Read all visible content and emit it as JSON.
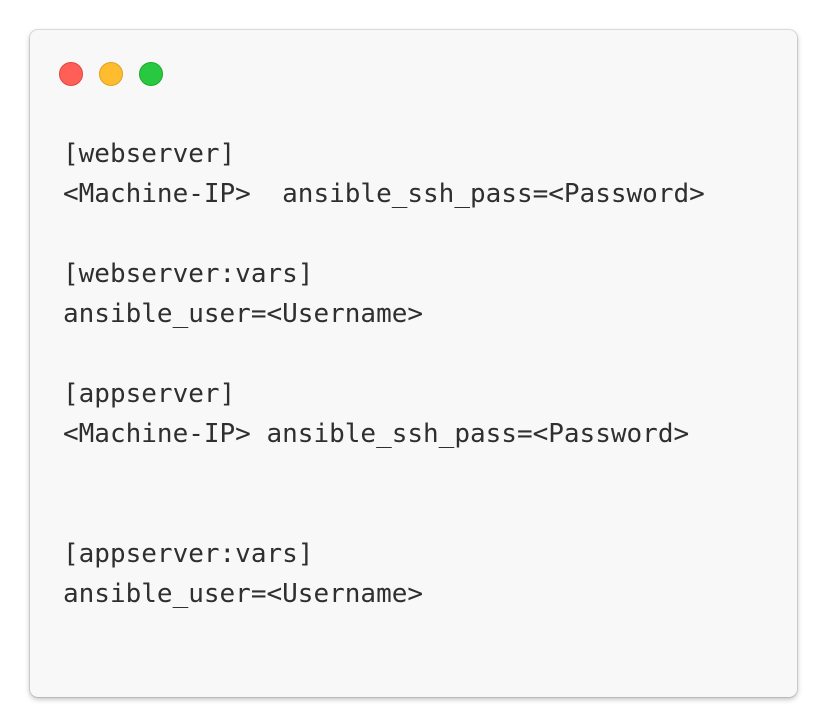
{
  "window": {
    "controls": {
      "close_color": "#ff5f57",
      "minimize_color": "#febc2e",
      "zoom_color": "#28c840"
    }
  },
  "code": {
    "lines": [
      "[webserver]",
      "<Machine-IP>  ansible_ssh_pass=<Password>",
      "",
      "[webserver:vars]",
      "ansible_user=<Username>",
      "",
      "[appserver]",
      "<Machine-IP> ansible_ssh_pass=<Password>",
      "",
      "",
      "[appserver:vars]",
      "ansible_user=<Username>"
    ]
  }
}
